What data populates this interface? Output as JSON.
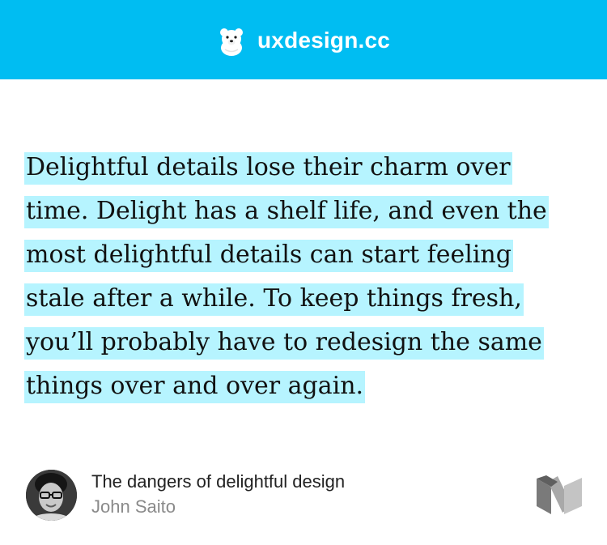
{
  "header": {
    "brand_name": "uxdesign.cc",
    "logo_icon": "polar-bear-icon",
    "background_color": "#00bdf2"
  },
  "quote": {
    "lines": [
      "Delightful details lose their charm over",
      "time. Delight has a shelf life, and even the",
      "most delightful details can start feeling",
      "stale after a while. To keep things fresh,",
      "you’ll probably have to redesign the same",
      "things over and over again."
    ],
    "highlight_color": "#b6f4ff"
  },
  "source": {
    "article_title": "The dangers of delightful design",
    "author": "John Saito",
    "publisher_icon": "medium-logo-icon"
  }
}
